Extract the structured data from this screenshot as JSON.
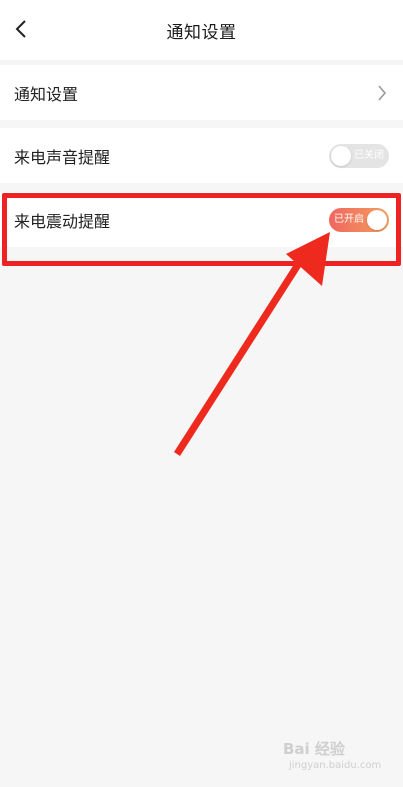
{
  "header": {
    "title": "通知设置",
    "back_icon": "chevron-left-icon"
  },
  "rows": [
    {
      "label": "通知设置",
      "control": "chevron-right-icon"
    },
    {
      "label": "来电声音提醒",
      "toggle": {
        "state": "off",
        "text": "已关闭"
      }
    },
    {
      "label": "来电震动提醒",
      "toggle": {
        "state": "on",
        "text": "已开启"
      }
    }
  ],
  "colors": {
    "background": "#f6f6f6",
    "toggle_on_start": "#f1665f",
    "toggle_on_end": "#f2a05f",
    "toggle_off": "#e4e4e4",
    "annotation_red": "#ee2222"
  },
  "watermark": {
    "brand": "Bai 经验",
    "url": "jingyan.baidu.com"
  }
}
